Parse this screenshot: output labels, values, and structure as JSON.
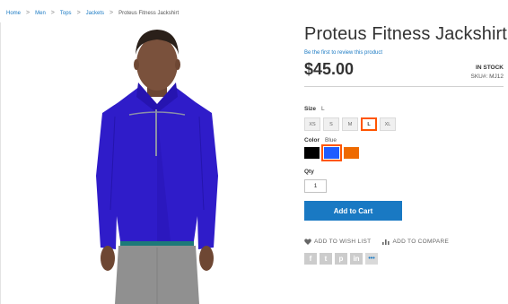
{
  "breadcrumb": {
    "items": [
      "Home",
      "Men",
      "Tops",
      "Jackets"
    ],
    "separator": ">",
    "current": "Proteus Fitness Jackshirt"
  },
  "product": {
    "title": "Proteus Fitness Jackshirt",
    "review_link": "Be the first to review this product",
    "price": "$45.00",
    "stock": "IN STOCK",
    "sku_label": "SKU#:",
    "sku": "MJ12"
  },
  "options": {
    "size_label": "Size",
    "size_selected": "L",
    "sizes": [
      "XS",
      "S",
      "M",
      "L",
      "XL"
    ],
    "color_label": "Color",
    "color_selected": "Blue",
    "colors": [
      {
        "name": "black",
        "hex": "#000000"
      },
      {
        "name": "blue",
        "hex": "#1d5cff"
      },
      {
        "name": "orange",
        "hex": "#ee6a00"
      }
    ]
  },
  "qty": {
    "label": "Qty",
    "value": "1"
  },
  "cart": {
    "label": "Add to Cart"
  },
  "actions": {
    "wishlist": "ADD TO WISH LIST",
    "compare": "ADD TO COMPARE"
  },
  "social": {
    "icons": [
      "facebook-icon",
      "twitter-icon",
      "pinterest-icon",
      "linkedin-icon",
      "more-icon"
    ],
    "labels": [
      "f",
      "t",
      "p",
      "in",
      "•••"
    ]
  },
  "colors": {
    "accent": "#1979c3",
    "selected_border": "#ff5501"
  }
}
